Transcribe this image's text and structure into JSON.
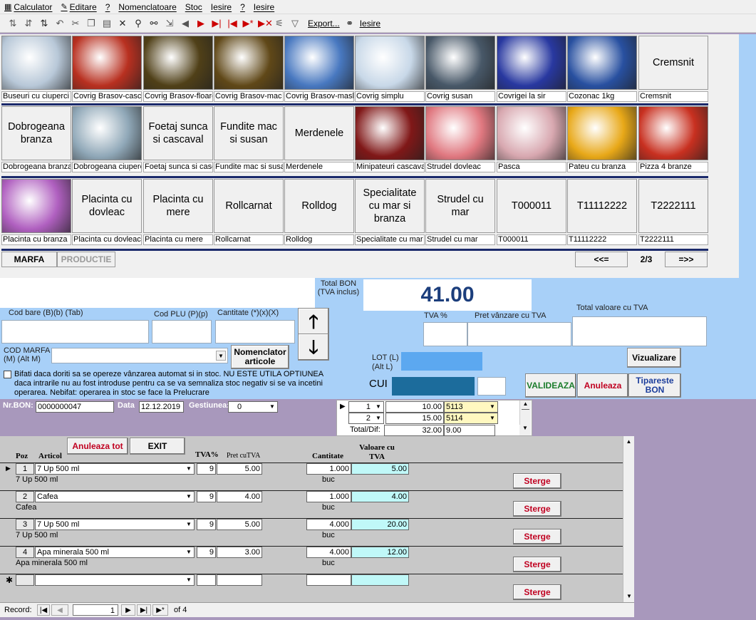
{
  "menu": [
    {
      "label": "Calculator",
      "icon": "calculator-icon"
    },
    {
      "label": "Editare",
      "icon": "edit-icon"
    },
    {
      "label": "?",
      "icon": ""
    },
    {
      "label": "Nomenclatoare",
      "icon": ""
    },
    {
      "label": "Stoc",
      "icon": ""
    },
    {
      "label": "Iesire",
      "icon": ""
    },
    {
      "label": "?",
      "icon": ""
    },
    {
      "label": "Iesire",
      "icon": ""
    }
  ],
  "toolbar": {
    "export_label": "Export...",
    "exit_label": "Iesire"
  },
  "tiles": [
    {
      "type": "img",
      "label": "Buseuri cu ciuperci",
      "color": "#b8c8d8"
    },
    {
      "type": "img",
      "label": "Covrig Brasov-casca",
      "color": "#b83020"
    },
    {
      "type": "img",
      "label": "Covrig Brasov-floare",
      "color": "#504018"
    },
    {
      "type": "img",
      "label": "Covrig Brasov-mac s",
      "color": "#604818"
    },
    {
      "type": "img",
      "label": "Covrig Brasov-maslin",
      "color": "#4878c0"
    },
    {
      "type": "img",
      "label": "Covrig simplu",
      "color": "#c8d8e8"
    },
    {
      "type": "img",
      "label": "Covrig susan",
      "color": "#485868"
    },
    {
      "type": "img",
      "label": "Covrigei la sir",
      "color": "#2838a0"
    },
    {
      "type": "img",
      "label": "Cozonac 1kg",
      "color": "#2850a0"
    },
    {
      "type": "text",
      "text": "Cremsnit",
      "label": "Cremsnit"
    },
    {
      "type": "text",
      "text": "Dobrogeana branza",
      "label": "Dobrogeana branza"
    },
    {
      "type": "img",
      "label": "Dobrogeana ciuperc",
      "color": "#90a8b8"
    },
    {
      "type": "text",
      "text": "Foetaj sunca si cascaval",
      "label": "Foetaj sunca si casc"
    },
    {
      "type": "text",
      "text": "Fundite mac si susan",
      "label": "Fundite mac si susar"
    },
    {
      "type": "text",
      "text": "Merdenele",
      "label": "Merdenele"
    },
    {
      "type": "img",
      "label": "Minipateuri cascaval",
      "color": "#801818"
    },
    {
      "type": "img",
      "label": "Strudel dovleac",
      "color": "#e07880"
    },
    {
      "type": "img",
      "label": "Pasca",
      "color": "#d8a8b0"
    },
    {
      "type": "img",
      "label": "Pateu cu branza",
      "color": "#e8a818"
    },
    {
      "type": "img",
      "label": "Pizza 4 branze",
      "color": "#c83020"
    },
    {
      "type": "img",
      "label": "Placinta cu branza",
      "color": "#b060c0"
    },
    {
      "type": "text",
      "text": "Placinta cu dovleac",
      "label": "Placinta cu dovleac"
    },
    {
      "type": "text",
      "text": "Placinta cu mere",
      "label": "Placinta cu mere"
    },
    {
      "type": "text",
      "text": "Rollcarnat",
      "label": "Rollcarnat"
    },
    {
      "type": "text",
      "text": "Rolldog",
      "label": "Rolldog"
    },
    {
      "type": "text",
      "text": "Specialitate cu mar si branza",
      "label": "Specialitate cu mar s"
    },
    {
      "type": "text",
      "text": "Strudel cu mar",
      "label": "Strudel cu mar"
    },
    {
      "type": "text",
      "text": "T000011",
      "label": "T000011"
    },
    {
      "type": "text",
      "text": "T11112222",
      "label": "T11112222"
    },
    {
      "type": "text",
      "text": "T2222111",
      "label": "T2222111"
    }
  ],
  "tabs": {
    "marfa": "MARFA",
    "productie": "PRODUCTIE"
  },
  "pager": {
    "prev": "<<=",
    "page": "2/3",
    "next": "=>>"
  },
  "total": {
    "label": "Total BON (TVA inclus)",
    "value": "41.00"
  },
  "fields": {
    "cod_bare": "Cod bare (B)(b) (Tab)",
    "cod_plu": "Cod PLU (P)(p)",
    "cantitate": "Cantitate (*)(x)(X)",
    "tva": "TVA %",
    "pret_vanzare": "Pret vânzare cu TVA",
    "total_valoare": "Total valoare cu TVA",
    "cod_marfa": "COD MARFA (M) (Alt M)",
    "lot": "LOT (L) (Alt L)",
    "cui": "CUI"
  },
  "buttons": {
    "nomenclator": "Nomenclator articole",
    "vizualizare": "Vizualizare",
    "valideaza": "VALIDEAZA",
    "anuleaza": "Anuleaza",
    "tipareste": "Tipareste BON",
    "anuleaza_tot": "Anuleaza tot",
    "exit": "EXIT",
    "sterge": "Sterge"
  },
  "checkbox_text": "Bifati daca doriti sa se opereze vânzarea automat si in stoc. NU ESTE UTILA OPTIUNEA daca intrarile nu au fost introduse pentru ca se va semnaliza stoc negativ si se va incetini operarea. Nebifat: operarea in stoc se face la Prelucrare",
  "bon": {
    "nr_label": "Nr.BON:",
    "nr": "0000000047",
    "data_label": "Data",
    "data": "12.12.2019",
    "gest_label": "Gestiunea:",
    "gest": "0"
  },
  "payments": [
    {
      "nr": "1",
      "suma": "10.00",
      "cod": "5113"
    },
    {
      "nr": "2",
      "suma": "15.00",
      "cod": "5114"
    }
  ],
  "totdif": {
    "label": "Total/Dif:",
    "total": "32.00",
    "dif": "9.00"
  },
  "columns": {
    "poz": "Poz",
    "articol": "Articol",
    "tva": "TVA%",
    "pret": "Pret cuTVA",
    "cant": "Cantitate",
    "val": "Valoare cu TVA"
  },
  "rows": [
    {
      "poz": "1",
      "articol": "7 Up 500 ml",
      "tva": "9",
      "pret": "5.00",
      "cant": "1.000",
      "val": "5.00",
      "desc": "7 Up 500 ml",
      "um": "buc"
    },
    {
      "poz": "2",
      "articol": "Cafea",
      "tva": "9",
      "pret": "4.00",
      "cant": "1.000",
      "val": "4.00",
      "desc": "Cafea",
      "um": "buc"
    },
    {
      "poz": "3",
      "articol": "7 Up 500 ml",
      "tva": "9",
      "pret": "5.00",
      "cant": "4.000",
      "val": "20.00",
      "desc": "7 Up 500 ml",
      "um": "buc"
    },
    {
      "poz": "4",
      "articol": "Apa minerala 500 ml",
      "tva": "9",
      "pret": "3.00",
      "cant": "4.000",
      "val": "12.00",
      "desc": "Apa minerala 500 ml",
      "um": "buc"
    }
  ],
  "record": {
    "label": "Record:",
    "current": "1",
    "of": "of 4"
  }
}
